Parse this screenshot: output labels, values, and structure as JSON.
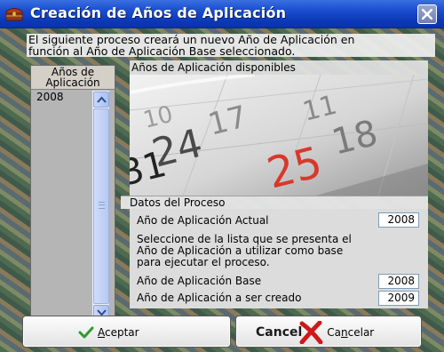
{
  "window": {
    "title": "Creación de Años de Aplicación"
  },
  "description": {
    "line1": "El siguiente proceso creará un nuevo Año de Aplicación en",
    "line2": "función al Año de Aplicación Base seleccionado."
  },
  "year_list": {
    "header_line1": "Años de",
    "header_line2": "Aplicación",
    "items": [
      "2008"
    ]
  },
  "available_panel": {
    "label": "Años de Aplicación disponibles",
    "calendar_numbers": [
      "10",
      "17",
      "24",
      "31",
      "11",
      "18",
      "25"
    ]
  },
  "process_data": {
    "label": "Datos del Proceso",
    "current_year_label": "Año de Aplicación Actual",
    "current_year_value": "2008",
    "instructions_line1": "Seleccione de la lista que se presenta el",
    "instructions_line2": "Año de Aplicación a utilizar como base",
    "instructions_line3": "para ejecutar el proceso.",
    "base_year_label": "Año de Aplicación Base",
    "base_year_value": "2008",
    "new_year_label": "Año de Aplicación a ser creado",
    "new_year_value": "2009"
  },
  "buttons": {
    "accept_accel": "A",
    "accept_rest": "ceptar",
    "cancel_icon_text": "Cancel",
    "cancel_pre": "Ca",
    "cancel_accel": "n",
    "cancel_post": "celar"
  },
  "colors": {
    "titlebar": "#1c4fd0",
    "accept_check": "#2e9a2e",
    "cancel_x": "#d01818"
  }
}
